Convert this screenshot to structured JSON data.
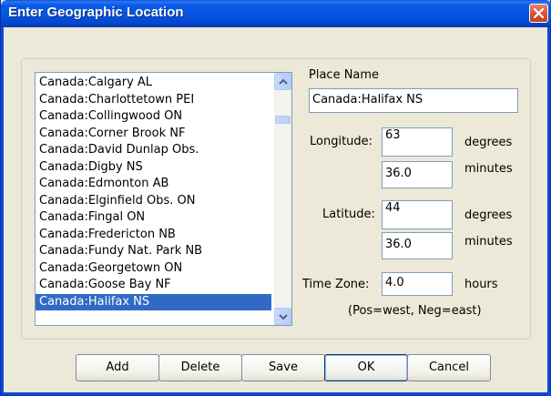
{
  "window": {
    "title": "Enter Geographic Location"
  },
  "places": {
    "items": [
      "Canada:Calgary AL",
      "Canada:Charlottetown PEI",
      "Canada:Collingwood ON",
      "Canada:Corner Brook NF",
      "Canada:David Dunlap Obs.",
      "Canada:Digby NS",
      "Canada:Edmonton AB",
      "Canada:Elginfield Obs. ON",
      "Canada:Fingal ON",
      "Canada:Fredericton NB",
      "Canada:Fundy Nat. Park NB",
      "Canada:Georgetown ON",
      "Canada:Goose Bay NF",
      "Canada:Halifax NS"
    ],
    "selected": "Canada:Halifax NS"
  },
  "form": {
    "place_name_label": "Place Name",
    "place_name_value": "Canada:Halifax NS",
    "longitude_label": "Longitude:",
    "longitude_degrees": "63",
    "longitude_minutes": "36.0",
    "latitude_label": "Latitude:",
    "latitude_degrees": "44",
    "latitude_minutes": "36.0",
    "degrees_unit": "degrees",
    "minutes_unit": "minutes",
    "timezone_label": "Time Zone:",
    "timezone_value": "4.0",
    "hours_unit": "hours",
    "timezone_hint": "(Pos=west, Neg=east)"
  },
  "buttons": {
    "add": "Add",
    "delete": "Delete",
    "save": "Save",
    "ok": "OK",
    "cancel": "Cancel"
  },
  "colors": {
    "titlebar": "#0453df",
    "selection": "#316ac5",
    "close_button": "#d54e2c",
    "dialog_background": "#ece9d8"
  },
  "icons": {
    "close": "close-icon",
    "scroll_up": "chevron-up-icon",
    "scroll_down": "chevron-down-icon"
  }
}
